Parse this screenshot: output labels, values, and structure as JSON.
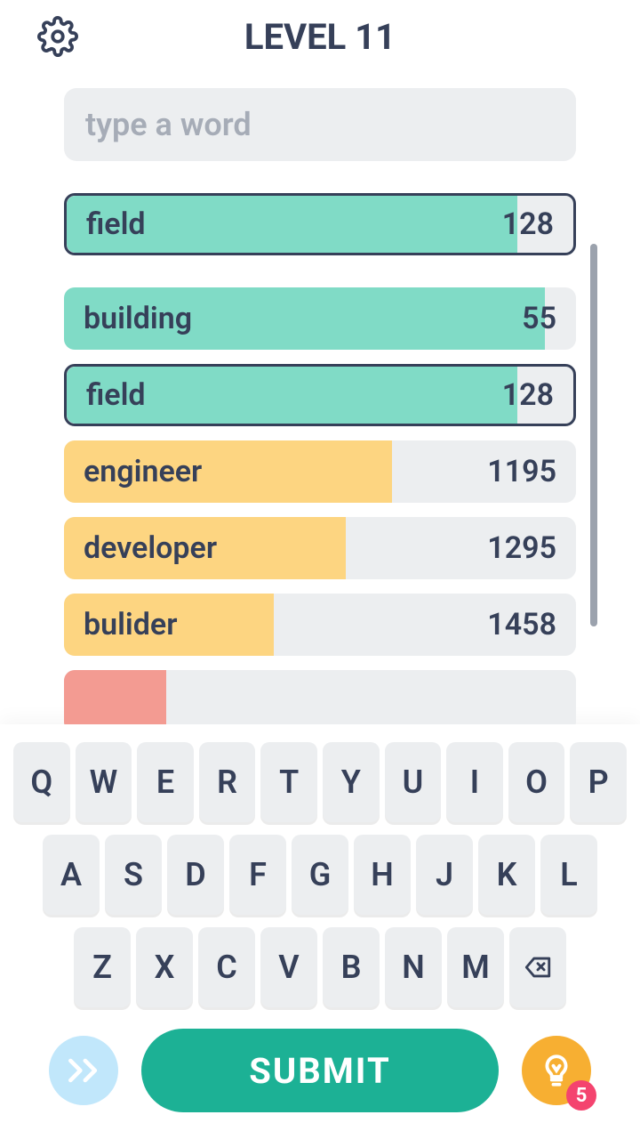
{
  "header": {
    "title": "LEVEL 11"
  },
  "input": {
    "placeholder": "type a word"
  },
  "guesses": [
    {
      "word": "field",
      "score": "128",
      "fill_pct": 89,
      "color": "teal",
      "bordered": true
    },
    {
      "word": "building",
      "score": "55",
      "fill_pct": 94,
      "color": "teal",
      "bordered": false
    },
    {
      "word": "field",
      "score": "128",
      "fill_pct": 89,
      "color": "teal",
      "bordered": true
    },
    {
      "word": "engineer",
      "score": "1195",
      "fill_pct": 64,
      "color": "yellow",
      "bordered": false
    },
    {
      "word": "developer",
      "score": "1295",
      "fill_pct": 55,
      "color": "yellow",
      "bordered": false
    },
    {
      "word": "bulider",
      "score": "1458",
      "fill_pct": 41,
      "color": "yellow",
      "bordered": false
    },
    {
      "word": "",
      "score": "",
      "fill_pct": 20,
      "color": "red",
      "bordered": false
    }
  ],
  "keyboard": {
    "row1": [
      "Q",
      "W",
      "E",
      "R",
      "T",
      "Y",
      "U",
      "I",
      "O",
      "P"
    ],
    "row2": [
      "A",
      "S",
      "D",
      "F",
      "G",
      "H",
      "J",
      "K",
      "L"
    ],
    "row3": [
      "Z",
      "X",
      "C",
      "V",
      "B",
      "N",
      "M"
    ]
  },
  "buttons": {
    "submit_label": "SUBMIT",
    "hint_count": "5"
  }
}
